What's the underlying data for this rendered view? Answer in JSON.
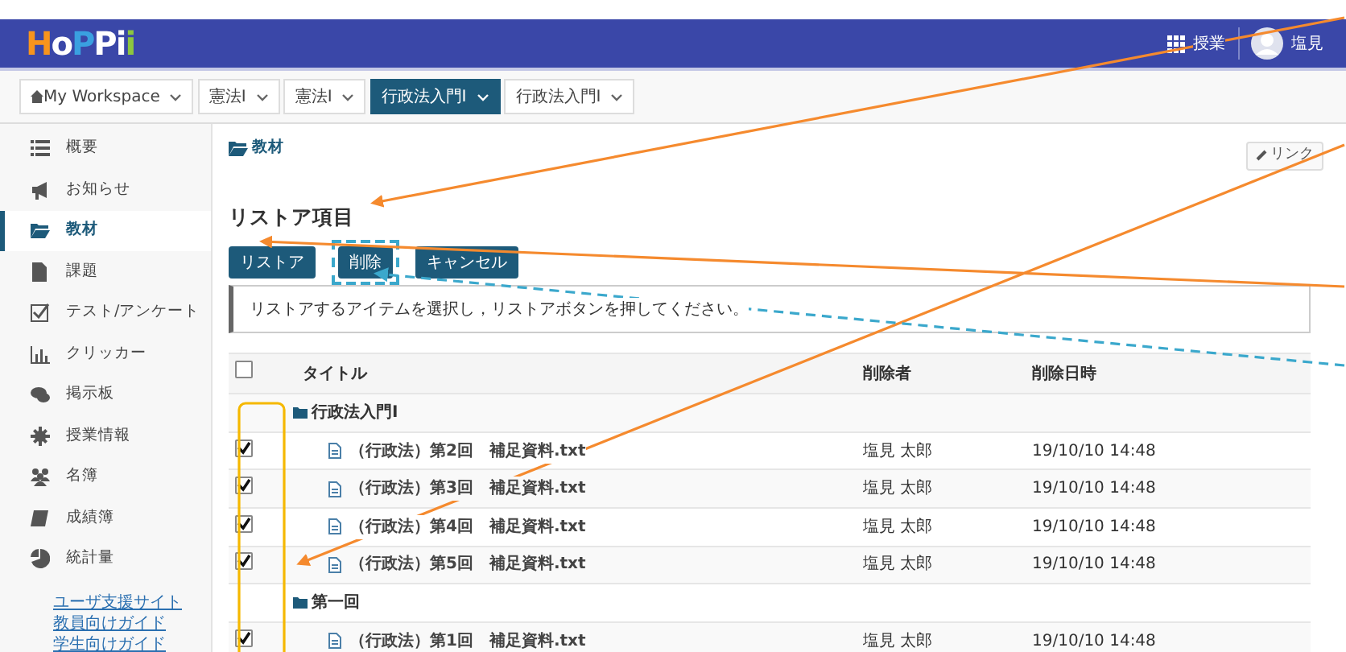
{
  "header": {
    "logo": "HoPPii",
    "apps_label": "授業",
    "user_name": "塩見"
  },
  "site_tabs": [
    {
      "label": "My Workspace",
      "selected": false,
      "home": true
    },
    {
      "label": "憲法Ⅰ",
      "selected": false
    },
    {
      "label": "憲法Ⅰ",
      "selected": false
    },
    {
      "label": "行政法入門Ⅰ",
      "selected": true
    },
    {
      "label": "行政法入門Ⅰ",
      "selected": false
    }
  ],
  "sidebar": {
    "items": [
      {
        "label": "概要",
        "selected": false
      },
      {
        "label": "お知らせ",
        "selected": false
      },
      {
        "label": "教材",
        "selected": true
      },
      {
        "label": "課題",
        "selected": false
      },
      {
        "label": "テスト/アンケート",
        "selected": false
      },
      {
        "label": "クリッカー",
        "selected": false
      },
      {
        "label": "掲示板",
        "selected": false
      },
      {
        "label": "授業情報",
        "selected": false
      },
      {
        "label": "名簿",
        "selected": false
      },
      {
        "label": "成績簿",
        "selected": false
      },
      {
        "label": "統計量",
        "selected": false
      }
    ],
    "links": [
      "ユーザ支援サイト",
      "教員向けガイド",
      "学生向けガイド"
    ]
  },
  "breadcrumb": "教材",
  "link_button": "リンク",
  "title": "リストア項目",
  "buttons": [
    "リストア",
    "削除",
    "キャンセル"
  ],
  "instruction": "リストアするアイテムを選択し，リストアボタンを押してください。",
  "table": {
    "select_all_checked": false,
    "columns": [
      "タイトル",
      "削除者",
      "削除日時"
    ],
    "rows": [
      {
        "kind": "folder",
        "title": "行政法入門Ⅰ"
      },
      {
        "kind": "file",
        "checked": true,
        "title": "（行政法）第2回　補足資料.txt",
        "deleted_by": "塩見 太郎",
        "deleted_at": "19/10/10 14:48"
      },
      {
        "kind": "file",
        "checked": true,
        "title": "（行政法）第3回　補足資料.txt",
        "deleted_by": "塩見 太郎",
        "deleted_at": "19/10/10 14:48"
      },
      {
        "kind": "file",
        "checked": true,
        "title": "（行政法）第4回　補足資料.txt",
        "deleted_by": "塩見 太郎",
        "deleted_at": "19/10/10 14:48"
      },
      {
        "kind": "file",
        "checked": true,
        "title": "（行政法）第5回　補足資料.txt",
        "deleted_by": "塩見 太郎",
        "deleted_at": "19/10/10 14:48"
      },
      {
        "kind": "folder",
        "title": "第一回"
      },
      {
        "kind": "file",
        "checked": true,
        "title": "（行政法）第1回　補足資料.txt",
        "deleted_by": "塩見 太郎",
        "deleted_at": "19/10/10 14:48"
      }
    ]
  }
}
